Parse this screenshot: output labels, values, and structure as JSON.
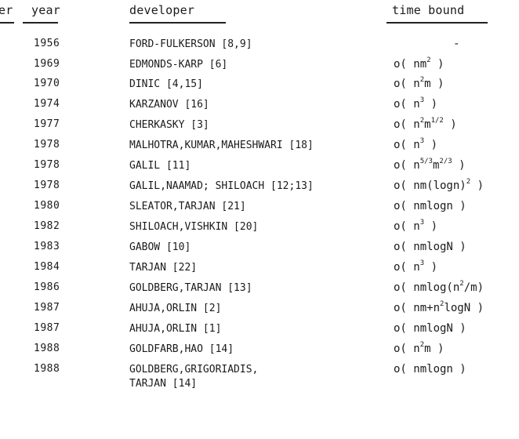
{
  "headers": {
    "number": "er",
    "year": "year",
    "developer": "developer",
    "time_bound": "time bound"
  },
  "rows": [
    {
      "year": "1956",
      "developer": "FORD-FULKERSON [8,9]",
      "time_bound": "-"
    },
    {
      "year": "1969",
      "developer": "EDMONDS-KARP [6]",
      "time_bound": "o( nm^2 )"
    },
    {
      "year": "1970",
      "developer": "DINIC [4,15]",
      "time_bound": "o( n^2m )"
    },
    {
      "year": "1974",
      "developer": "KARZANOV [16]",
      "time_bound": "o( n^3 )"
    },
    {
      "year": "1977",
      "developer": "CHERKASKY [3]",
      "time_bound": "o( n^2m^1/2 )"
    },
    {
      "year": "1978",
      "developer": "MALHOTRA,KUMAR,MAHESHWARI [18]",
      "time_bound": "o( n^3 )"
    },
    {
      "year": "1978",
      "developer": "GALIL [11]",
      "time_bound": "o( n^5/3m^2/3 )"
    },
    {
      "year": "1978",
      "developer": "GALIL,NAAMAD; SHILOACH [12;13]",
      "time_bound": "o( nm(logn)^2 )"
    },
    {
      "year": "1980",
      "developer": "SLEATOR,TARJAN [21]",
      "time_bound": "o( nmlogn )"
    },
    {
      "year": "1982",
      "developer": "SHILOACH,VISHKIN [20]",
      "time_bound": "o( n^3 )"
    },
    {
      "year": "1983",
      "developer": "GABOW [10]",
      "time_bound": "o( nmlogN )"
    },
    {
      "year": "1984",
      "developer": "TARJAN [22]",
      "time_bound": "o( n^3 )"
    },
    {
      "year": "1986",
      "developer": "GOLDBERG,TARJAN [13]",
      "time_bound": "o( nmlog(n^2/m)"
    },
    {
      "year": "1987",
      "developer": "AHUJA,ORLIN [2]",
      "time_bound": "o( nm+n^2logN )"
    },
    {
      "year": "1987",
      "developer": "AHUJA,ORLIN [1]",
      "time_bound": "o( nmlogN )"
    },
    {
      "year": "1988",
      "developer": "GOLDFARB,HAO [14]",
      "time_bound": "o( n^2m )"
    },
    {
      "year": "1988",
      "developer": "GOLDBERG,GRIGORIADIS,\nTARJAN [14]",
      "time_bound": "o( nmlogn )"
    }
  ],
  "time_bound_parts": [
    [
      [
        "-"
      ]
    ],
    [
      [
        "o( nm"
      ],
      [
        "2",
        "sup"
      ],
      [
        " )"
      ]
    ],
    [
      [
        "o( n"
      ],
      [
        "2",
        "sup"
      ],
      [
        "m )"
      ]
    ],
    [
      [
        "o( n"
      ],
      [
        "3",
        "sup"
      ],
      [
        " )"
      ]
    ],
    [
      [
        "o( n"
      ],
      [
        "2",
        "sup"
      ],
      [
        "m"
      ],
      [
        "1/2",
        "sup"
      ],
      [
        " )"
      ]
    ],
    [
      [
        "o( n"
      ],
      [
        "3",
        "sup"
      ],
      [
        " )"
      ]
    ],
    [
      [
        "o( n"
      ],
      [
        "5/3",
        "sup"
      ],
      [
        "m"
      ],
      [
        "2/3",
        "sup"
      ],
      [
        " )"
      ]
    ],
    [
      [
        "o( nm(logn)"
      ],
      [
        "2",
        "sup"
      ],
      [
        " )"
      ]
    ],
    [
      [
        "o( nmlogn )"
      ]
    ],
    [
      [
        "o( n"
      ],
      [
        "3",
        "sup"
      ],
      [
        " )"
      ]
    ],
    [
      [
        "o( nmlogN )"
      ]
    ],
    [
      [
        "o( n"
      ],
      [
        "3",
        "sup"
      ],
      [
        " )"
      ]
    ],
    [
      [
        "o( nmlog(n"
      ],
      [
        "2",
        "sup"
      ],
      [
        "/m)"
      ]
    ],
    [
      [
        "o( nm+n"
      ],
      [
        "2",
        "sup"
      ],
      [
        "logN )"
      ]
    ],
    [
      [
        "o( nmlogN )"
      ]
    ],
    [
      [
        "o( n"
      ],
      [
        "2",
        "sup"
      ],
      [
        "m )"
      ]
    ],
    [
      [
        "o( nmlogn )"
      ]
    ]
  ]
}
